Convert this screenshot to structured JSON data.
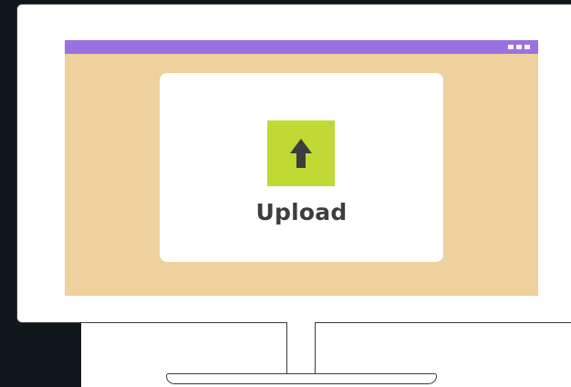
{
  "upload": {
    "label": "Upload",
    "icon": "arrow-up-icon"
  },
  "browser": {
    "menu_icon": "three-dots-icon"
  },
  "colors": {
    "page_background": "#10171a",
    "browser_bar": "#9a71e1",
    "browser_content": "#eed19d",
    "upload_button": "#c1d934",
    "text": "#3d3d3d"
  }
}
